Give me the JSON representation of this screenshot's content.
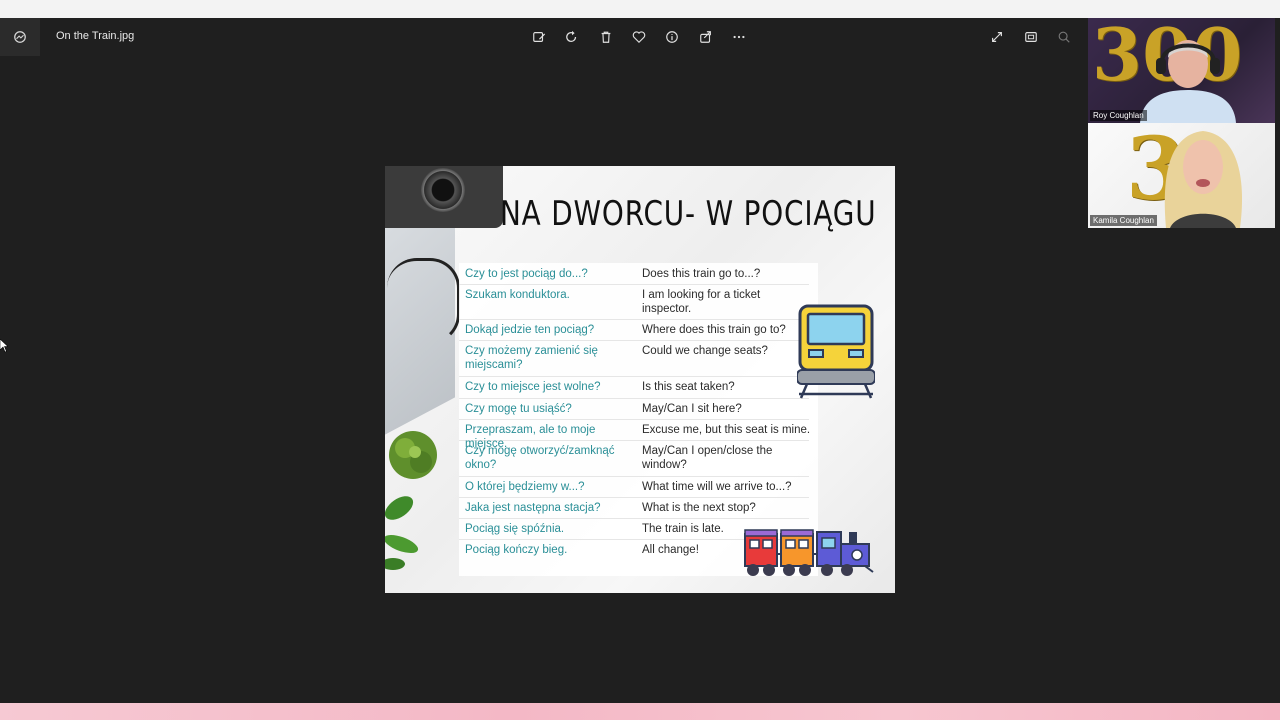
{
  "viewer": {
    "file_name": "On the Train.jpg",
    "toolbar_icons": [
      "edit-image-icon",
      "rotate-icon",
      "delete-icon",
      "favorite-icon",
      "info-icon",
      "share-icon",
      "more-icon"
    ],
    "right_icons": [
      "fullscreen-icon",
      "fit-window-icon",
      "zoom-icon"
    ]
  },
  "slide": {
    "title": "NA DWORCU- W POCIĄGU",
    "phrases": [
      {
        "pl": "Czy to jest pociąg do...?",
        "en": "Does this train go to...?"
      },
      {
        "pl": "Szukam konduktora.",
        "en": "I am looking for a ticket inspector."
      },
      {
        "pl": "Dokąd jedzie ten pociąg?",
        "en": "Where does this train go to?"
      },
      {
        "pl": "Czy możemy zamienić się miejscami?",
        "en": "Could we change seats?"
      },
      {
        "pl": "Czy to miejsce jest wolne?",
        "en": "Is this seat taken?"
      },
      {
        "pl": "Czy mogę tu usiąść?",
        "en": "May/Can I sit here?"
      },
      {
        "pl": "Przepraszam, ale to moje miejsce.",
        "en": "Excuse me, but this seat is mine."
      },
      {
        "pl": "Czy mogę otworzyć/zamknąć okno?",
        "en": "May/Can I open/close the window?"
      },
      {
        "pl": "O której będziemy w...?",
        "en": "What time will we arrive to...?"
      },
      {
        "pl": "Jaka jest następna stacja?",
        "en": "What is the next stop?"
      },
      {
        "pl": "Pociąg się spóźnia.",
        "en": "The train is late."
      },
      {
        "pl": "Pociąg kończy bieg.",
        "en": "All change!"
      }
    ]
  },
  "participants": [
    {
      "name": "Roy Coughlan",
      "backdrop_text": "300"
    },
    {
      "name": "Kamila Coughlan",
      "backdrop_text": "3"
    }
  ],
  "colors": {
    "viewer_bg": "#1f1f1f",
    "phrase_polish": "#2a8f97",
    "phrase_english": "#2b2b2b",
    "gold": "#c9a227"
  }
}
